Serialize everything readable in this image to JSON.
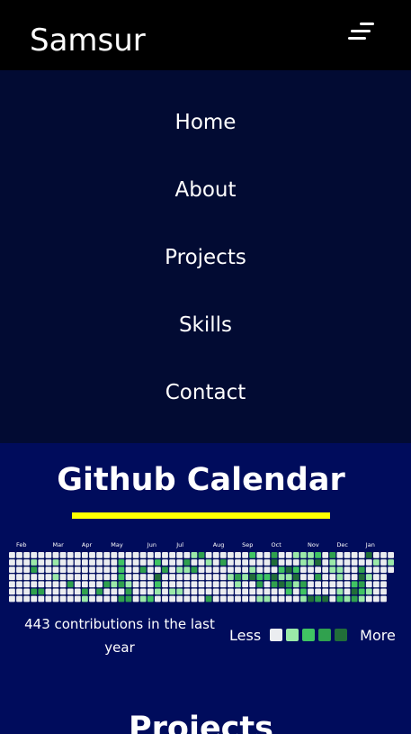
{
  "header": {
    "brand": "Samsur",
    "menu_icon": "hamburger-menu-icon"
  },
  "nav": {
    "items": [
      "Home",
      "About",
      "Projects",
      "Skills",
      "Contact"
    ]
  },
  "github": {
    "title": "Github Calendar",
    "months": [
      "Feb",
      "Mar",
      "Apr",
      "May",
      "Jun",
      "Jul",
      "Aug",
      "Sep",
      "Oct",
      "Nov",
      "Dec",
      "Jan"
    ],
    "summary": "443 contributions in the last year",
    "legend_less": "Less",
    "legend_more": "More"
  },
  "projects": {
    "title": "Projects"
  },
  "colors": {
    "level_0": "#ebedf0",
    "level_1": "#9be9a8",
    "level_2": "#40c463",
    "level_3": "#30a14e",
    "level_4": "#216e39",
    "accent": "#ffff00"
  }
}
